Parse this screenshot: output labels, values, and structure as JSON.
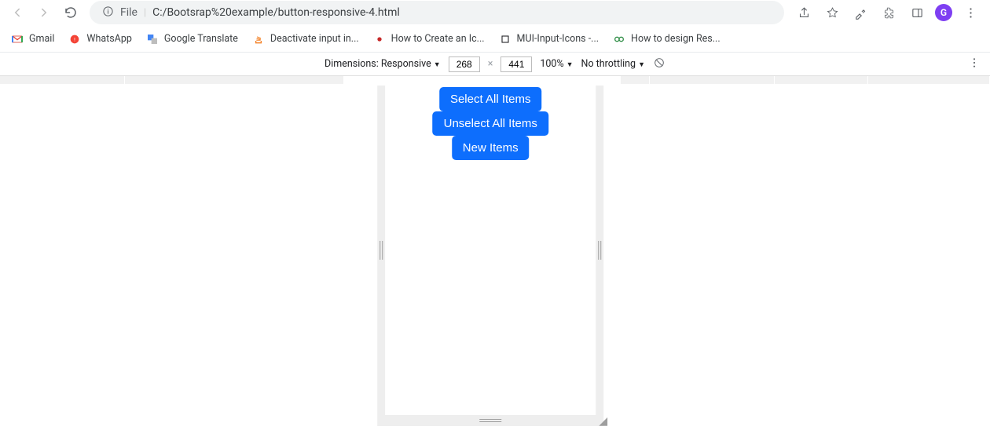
{
  "toolbar": {
    "file_label": "File",
    "url": "C:/Bootsrap%20example/button-responsive-4.html",
    "avatar_initial": "G"
  },
  "bookmarks": [
    {
      "label": "Gmail",
      "icon": "gmail"
    },
    {
      "label": "WhatsApp",
      "icon": "whatsapp"
    },
    {
      "label": "Google Translate",
      "icon": "gtranslate"
    },
    {
      "label": "Deactivate input in...",
      "icon": "so"
    },
    {
      "label": "How to Create an Ic...",
      "icon": "red-dot"
    },
    {
      "label": "MUI-Input-Icons -...",
      "icon": "box"
    },
    {
      "label": "How to design Res...",
      "icon": "gfg"
    }
  ],
  "devtools": {
    "dimensions_label": "Dimensions: Responsive",
    "width": "268",
    "height": "441",
    "zoom": "100%",
    "throttling": "No throttling"
  },
  "page": {
    "button1": "Select All Items",
    "button2": "Unselect All Items",
    "button3": "New Items"
  }
}
